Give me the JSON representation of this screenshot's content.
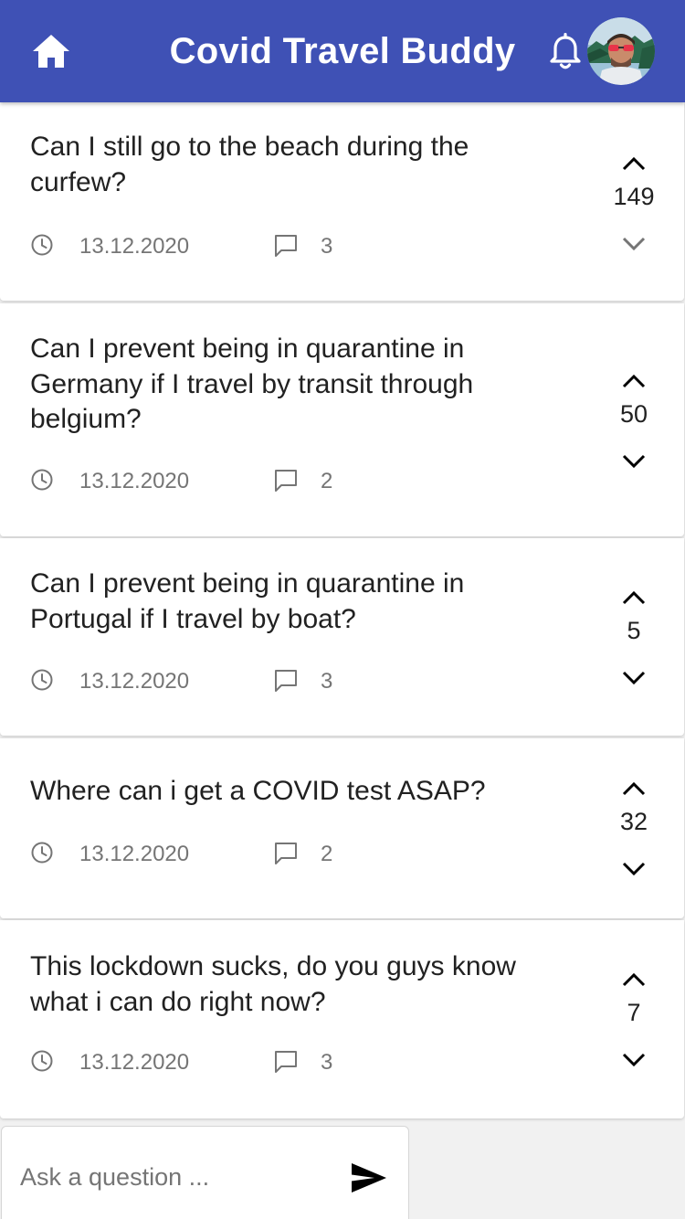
{
  "app": {
    "title": "Covid Travel Buddy",
    "accent_color": "#3f51b5"
  },
  "header": {
    "left_icon": "home-icon",
    "right_icons": [
      "bell-icon",
      "user-avatar"
    ]
  },
  "questions": [
    {
      "title": "Can I still go to the beach during the curfew?",
      "date": "13.12.2020",
      "comments": "3",
      "votes": "149"
    },
    {
      "title": "Can I prevent being in quarantine in Germany if I travel by transit through belgium?",
      "date": "13.12.2020",
      "comments": "2",
      "votes": "50"
    },
    {
      "title": "Can I prevent being in quarantine in Portugal if I travel by boat?",
      "date": "13.12.2020",
      "comments": "3",
      "votes": "5"
    },
    {
      "title": "Where can i get a COVID test ASAP?",
      "date": "13.12.2020",
      "comments": "2",
      "votes": "32"
    },
    {
      "title": "This lockdown sucks, do you guys know what i can do right now?",
      "date": "13.12.2020",
      "comments": "3",
      "votes": "7"
    }
  ],
  "ask": {
    "placeholder": "Ask a question ...",
    "value": "",
    "send_icon": "send-icon"
  }
}
